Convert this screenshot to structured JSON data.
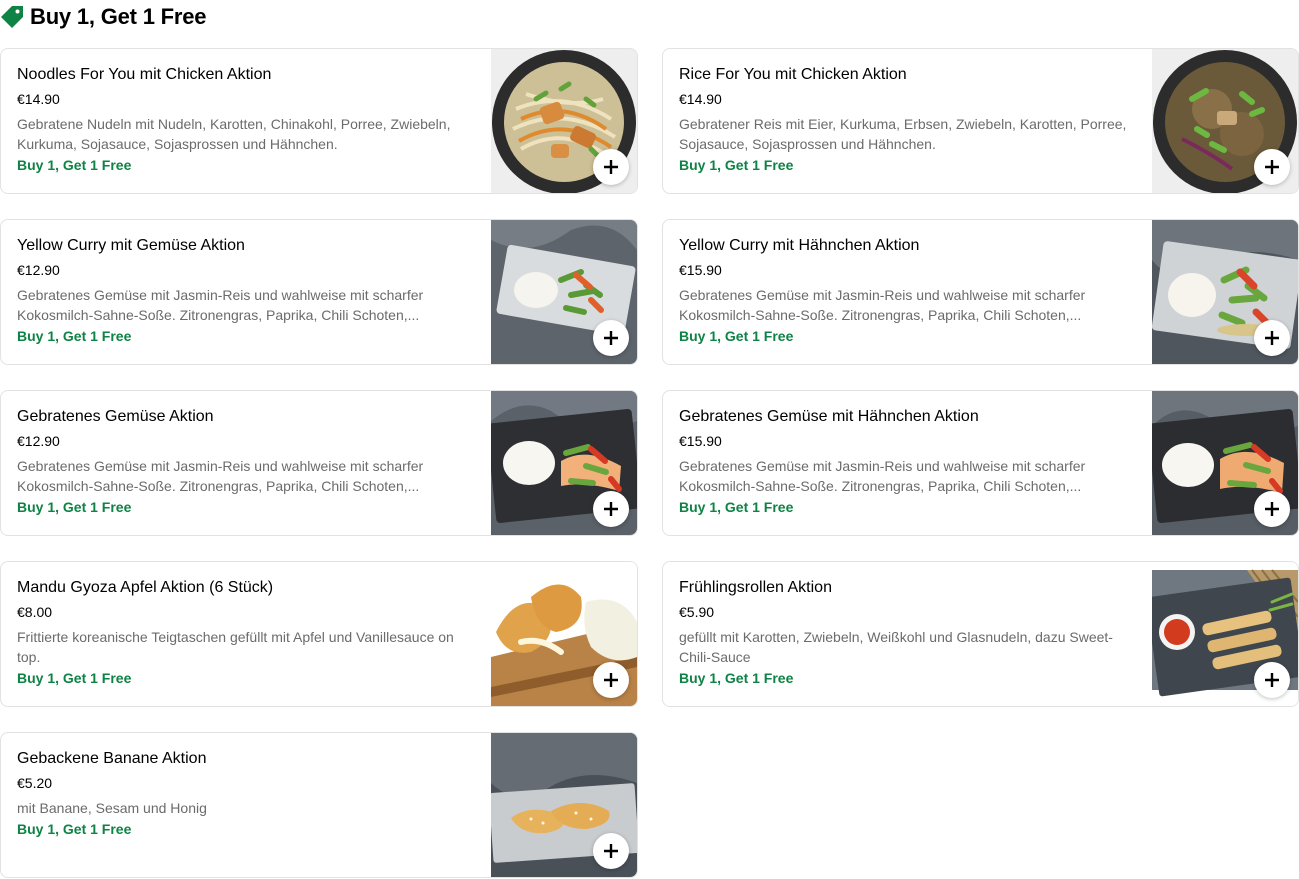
{
  "section": {
    "title": "Buy 1, Get 1 Free",
    "icon": "price-tag-icon",
    "icon_color": "#0e8345"
  },
  "colors": {
    "promo": "#0e8345",
    "description": "#6b6b6b",
    "card_border": "#e2e2e2"
  },
  "add_icon": "plus-icon",
  "items": [
    {
      "name": "Noodles For You mit Chicken Aktion",
      "price": "€14.90",
      "description": "Gebratene Nudeln mit Nudeln, Karotten, Chinakohl, Porree, Zwiebeln, Kurkuma, Sojasauce, Sojasprossen und Hähnchen.",
      "promo": "Buy 1, Get 1 Free"
    },
    {
      "name": "Rice For You mit Chicken Aktion",
      "price": "€14.90",
      "description": "Gebratener Reis mit Eier, Kurkuma, Erbsen, Zwiebeln, Karotten, Porree, Sojasauce, Sojasprossen und Hähnchen.",
      "promo": "Buy 1, Get 1 Free"
    },
    {
      "name": "Yellow Curry mit Gemüse Aktion",
      "price": "€12.90",
      "description": "Gebratenes Gemüse mit Jasmin-Reis und wahlweise mit scharfer Kokosmilch-Sahne-Soße. Zitronengras, Paprika, Chili Schoten,...",
      "promo": "Buy 1, Get 1 Free"
    },
    {
      "name": "Yellow Curry mit Hähnchen Aktion",
      "price": "€15.90",
      "description": "Gebratenes Gemüse mit Jasmin-Reis und wahlweise mit scharfer Kokosmilch-Sahne-Soße. Zitronengras, Paprika, Chili Schoten,...",
      "promo": "Buy 1, Get 1 Free"
    },
    {
      "name": "Gebratenes Gemüse Aktion",
      "price": "€12.90",
      "description": "Gebratenes Gemüse mit Jasmin-Reis und wahlweise mit scharfer Kokosmilch-Sahne-Soße. Zitronengras, Paprika, Chili Schoten,...",
      "promo": "Buy 1, Get 1 Free"
    },
    {
      "name": "Gebratenes Gemüse mit Hähnchen Aktion",
      "price": "€15.90",
      "description": "Gebratenes Gemüse mit Jasmin-Reis und wahlweise mit scharfer Kokosmilch-Sahne-Soße. Zitronengras, Paprika, Chili Schoten,...",
      "promo": "Buy 1, Get 1 Free"
    },
    {
      "name": "Mandu Gyoza Apfel Aktion (6 Stück)",
      "price": "€8.00",
      "description": "Frittierte koreanische Teigtaschen gefüllt mit Apfel und Vanillesauce on top.",
      "promo": "Buy 1, Get 1 Free"
    },
    {
      "name": "Frühlingsrollen Aktion",
      "price": "€5.90",
      "description": "gefüllt mit Karotten, Zwiebeln, Weißkohl und Glasnudeln, dazu Sweet-Chili-Sauce",
      "promo": "Buy 1, Get 1 Free"
    },
    {
      "name": "Gebackene Banane Aktion",
      "price": "€5.20",
      "description": "mit Banane, Sesam und Honig",
      "promo": "Buy 1, Get 1 Free"
    }
  ]
}
